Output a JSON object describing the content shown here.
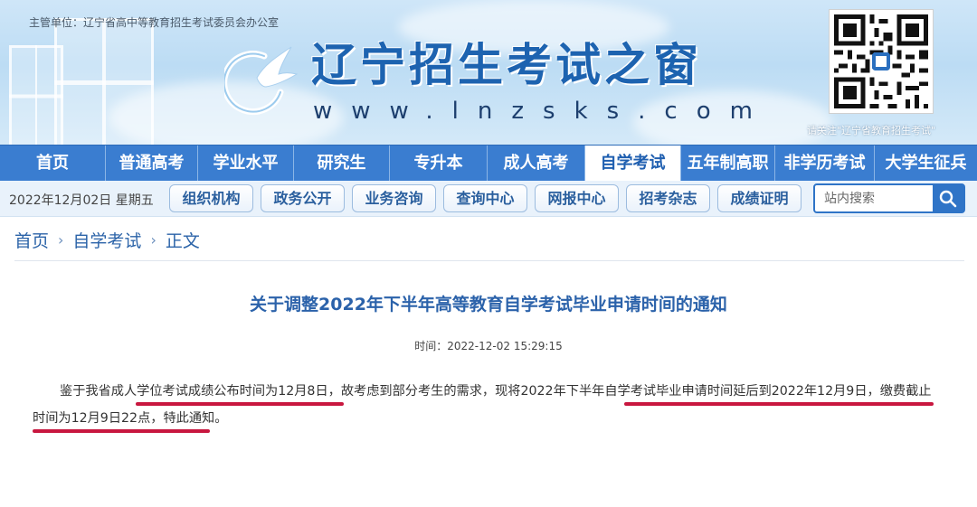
{
  "header": {
    "supervisor": "主管单位：辽宁省高中等教育招生考试委员会办公室",
    "site_title": "辽宁招生考试之窗",
    "site_url": "www.lnzsks.com",
    "qr_caption": "请关注\"辽宁省教育招生考试\""
  },
  "main_nav": [
    {
      "label": "首页"
    },
    {
      "label": "普通高考"
    },
    {
      "label": "学业水平"
    },
    {
      "label": "研究生"
    },
    {
      "label": "专升本"
    },
    {
      "label": "成人高考"
    },
    {
      "label": "自学考试",
      "active": true
    },
    {
      "label": "五年制高职"
    },
    {
      "label": "非学历考试"
    },
    {
      "label": "大学生征兵"
    }
  ],
  "sub_nav": {
    "date": "2022年12月02日 星期五",
    "buttons": [
      "组织机构",
      "政务公开",
      "业务咨询",
      "查询中心",
      "网报中心",
      "招考杂志",
      "成绩证明"
    ],
    "search_placeholder": "站内搜索"
  },
  "breadcrumb": [
    "首页",
    "自学考试",
    "正文"
  ],
  "article": {
    "title": "关于调整2022年下半年高等教育自学考试毕业申请时间的通知",
    "time": "时间：2022-12-02 15:29:15",
    "body": "鉴于我省成人学位考试成绩公布时间为12月8日，故考虑到部分考生的需求，现将2022年下半年自学考试毕业申请时间延后到2022年12月9日，缴费截止时间为12月9日22点，特此通知。"
  },
  "colors": {
    "nav_blue": "#3a7dd0",
    "title_blue": "#2b62aa",
    "underline_red": "#c8173f"
  }
}
